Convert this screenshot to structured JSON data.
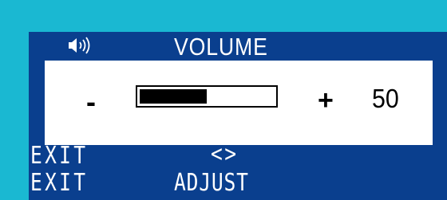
{
  "osd": {
    "title": "VOLUME",
    "icon": "speaker-icon",
    "minus_label": "-",
    "plus_label": "+",
    "value": "50",
    "level_fraction": 0.5
  },
  "footer": {
    "exit_top": "EXIT",
    "adjust_arrows": "<>",
    "exit_bottom": "EXIT",
    "adjust_label": "ADJUST"
  },
  "colors": {
    "background": "#1ab8d2",
    "osd_panel": "#0a3f8e",
    "content_panel": "#ffffff",
    "text_light": "#ffffff",
    "text_dark": "#000000"
  }
}
